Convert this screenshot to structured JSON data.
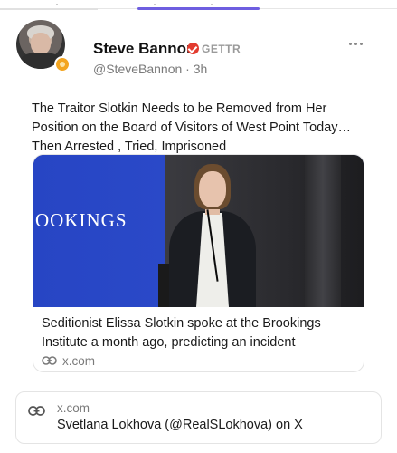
{
  "post": {
    "author_name": "Steve Bannon",
    "platform_tag": "GETTR",
    "handle": "@SteveBannon",
    "time_separator": "·",
    "time_ago": "3h",
    "text": "The Traitor Slotkin Needs to be Removed from Her Position on the Board of Visitors of West Point Today…Then Arrested , Tried, Imprisoned",
    "more_icon": "more-horizontal-icon",
    "verified_icon": "verified-check-icon",
    "avatar_badge_icon": "gold-badge-icon"
  },
  "link_card": {
    "image_text": "OOKINGS",
    "title": "Seditionist Elissa Slotkin spoke at the Brookings Institute a month ago, predicting an incident",
    "domain": "x.com",
    "icon": "link-icon"
  },
  "embed_card": {
    "domain": "x.com",
    "title": "Svetlana Lokhova (@RealSLokhova) on X",
    "icon": "link-icon"
  },
  "colors": {
    "accent": "#6e5ee0",
    "verified": "#e23b2f",
    "badge": "#f3a521",
    "muted_text": "#7a7a7a"
  }
}
